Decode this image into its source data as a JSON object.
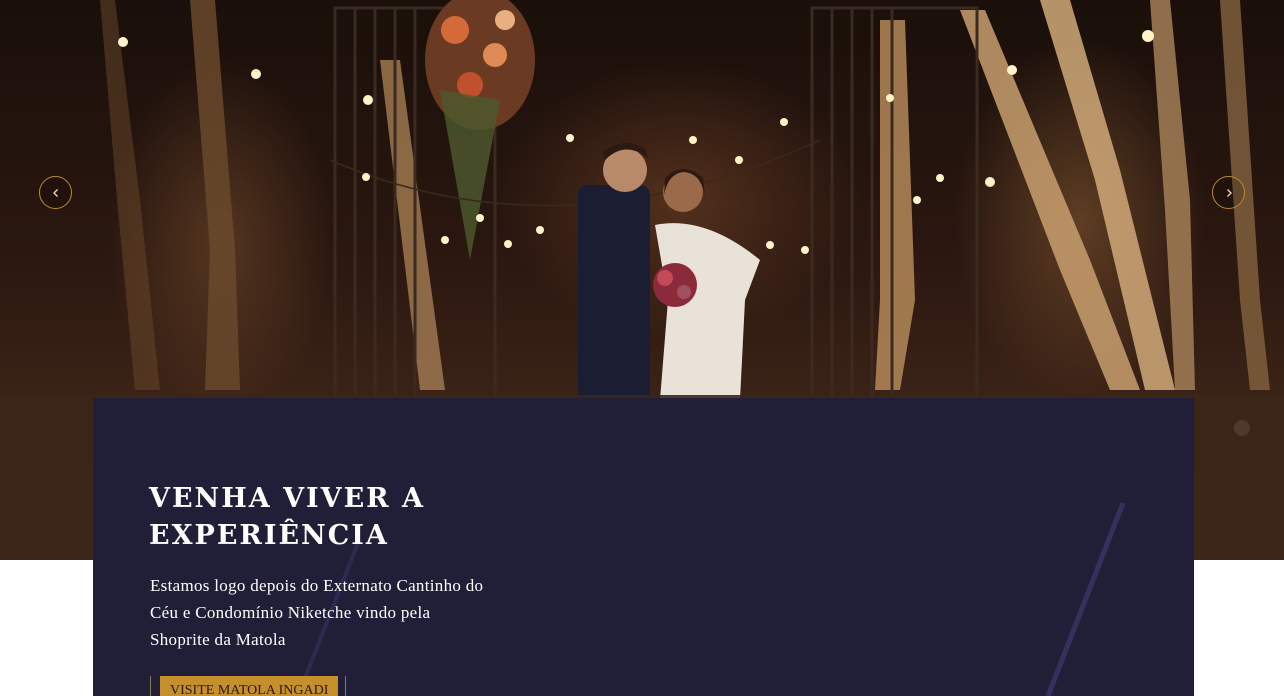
{
  "hero": {
    "image_alt": "Casal de noivos sob luzes suspensas numa floresta à noite",
    "prev_icon": "chevron-left-icon",
    "next_icon": "chevron-right-icon",
    "accent_color": "#b88c2c"
  },
  "panel": {
    "title": "Venha viver a experiência",
    "description": "Estamos logo depois do Externato Cantinho do Céu e Condomínio Niketche vindo pela Shoprite da Matola",
    "cta_label": "Visite Matola Ingadi",
    "background_color": "#211f38",
    "cta_color": "#c58f2b"
  }
}
